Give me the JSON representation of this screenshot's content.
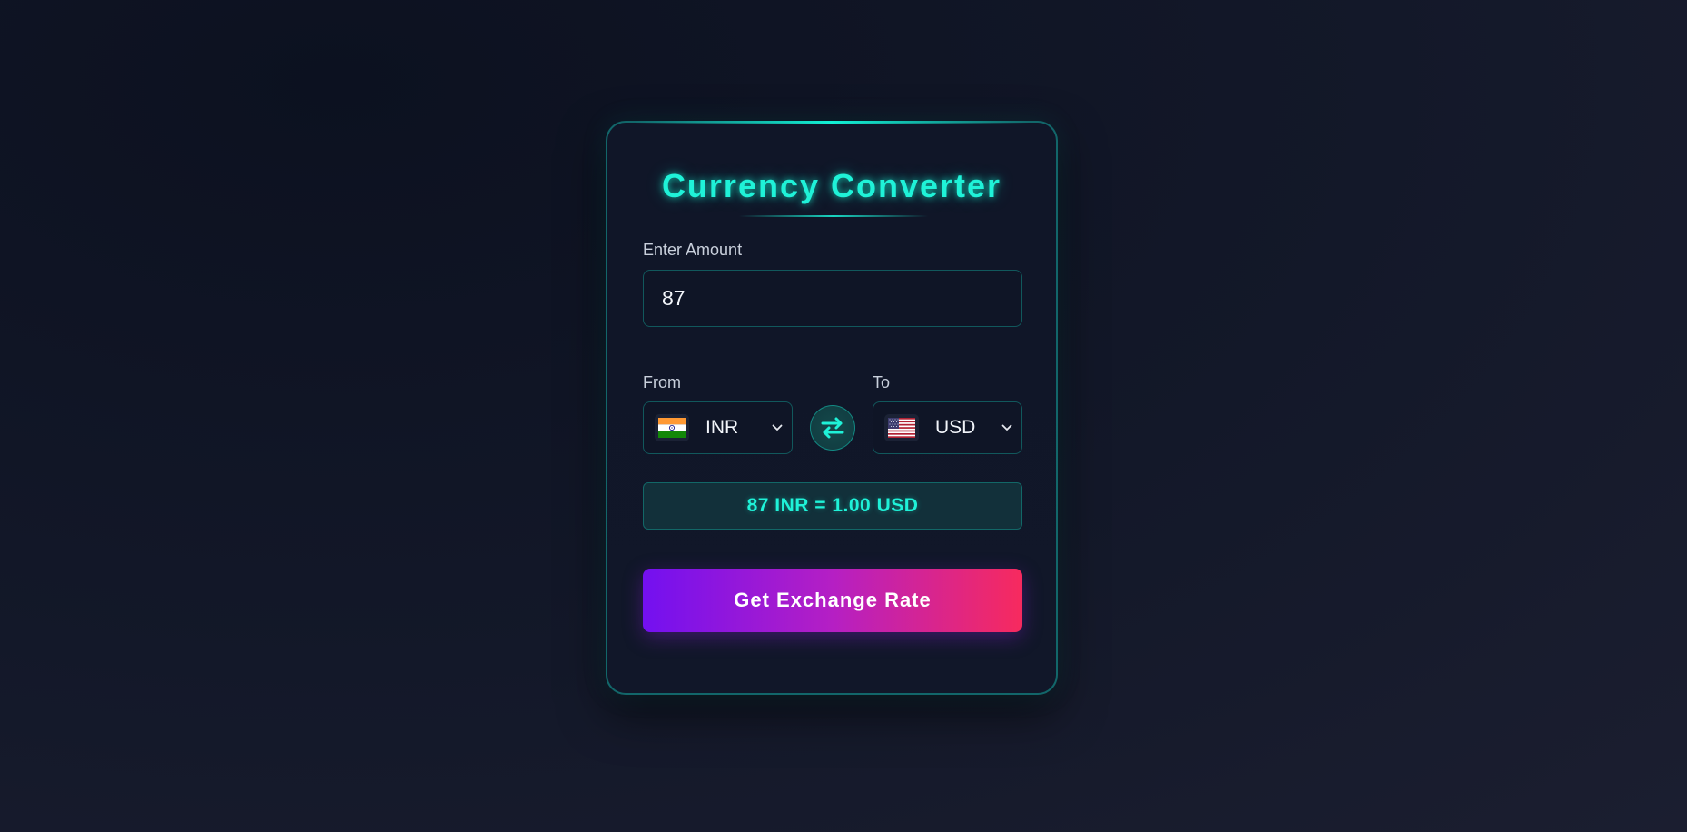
{
  "card": {
    "title": "Currency Converter"
  },
  "amount": {
    "label": "Enter Amount",
    "value": "87"
  },
  "from": {
    "label": "From",
    "currency": "INR",
    "flag": "india-flag-icon"
  },
  "to": {
    "label": "To",
    "currency": "USD",
    "flag": "us-flag-icon"
  },
  "swap": {
    "icon": "swap-arrows-icon"
  },
  "result": {
    "text": "87 INR = 1.00 USD"
  },
  "action": {
    "button_label": "Get Exchange Rate"
  },
  "colors": {
    "accent": "#1ff2d8",
    "button_start": "#7310f0",
    "button_end": "#f72a5e",
    "background": "#131829"
  }
}
